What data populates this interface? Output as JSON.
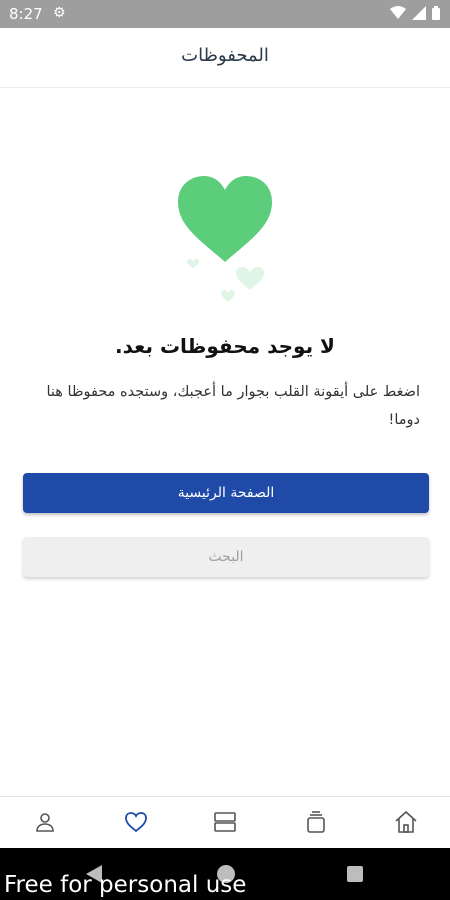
{
  "status_bar": {
    "time": "8:27"
  },
  "header": {
    "title": "المحفوظات"
  },
  "empty_state": {
    "title": "لا يوجد محفوظات بعد.",
    "description": "اضغط على أيقونة القلب بجوار ما أعجبك، وستجده محفوظا هنا دوما!"
  },
  "buttons": {
    "home_label": "الصفحة الرئيسية",
    "search_label": "البحث"
  },
  "colors": {
    "primary": "#1f4aa8",
    "heart": "#5ccd7a",
    "nav_active": "#1f4aa8",
    "nav_inactive": "#555555"
  },
  "bottom_nav": {
    "items": [
      {
        "icon": "user-icon",
        "active": false
      },
      {
        "icon": "heart-icon",
        "active": true
      },
      {
        "icon": "list-icon",
        "active": false
      },
      {
        "icon": "stack-icon",
        "active": false
      },
      {
        "icon": "home-icon",
        "active": false
      }
    ]
  },
  "watermark": "Free for personal use"
}
